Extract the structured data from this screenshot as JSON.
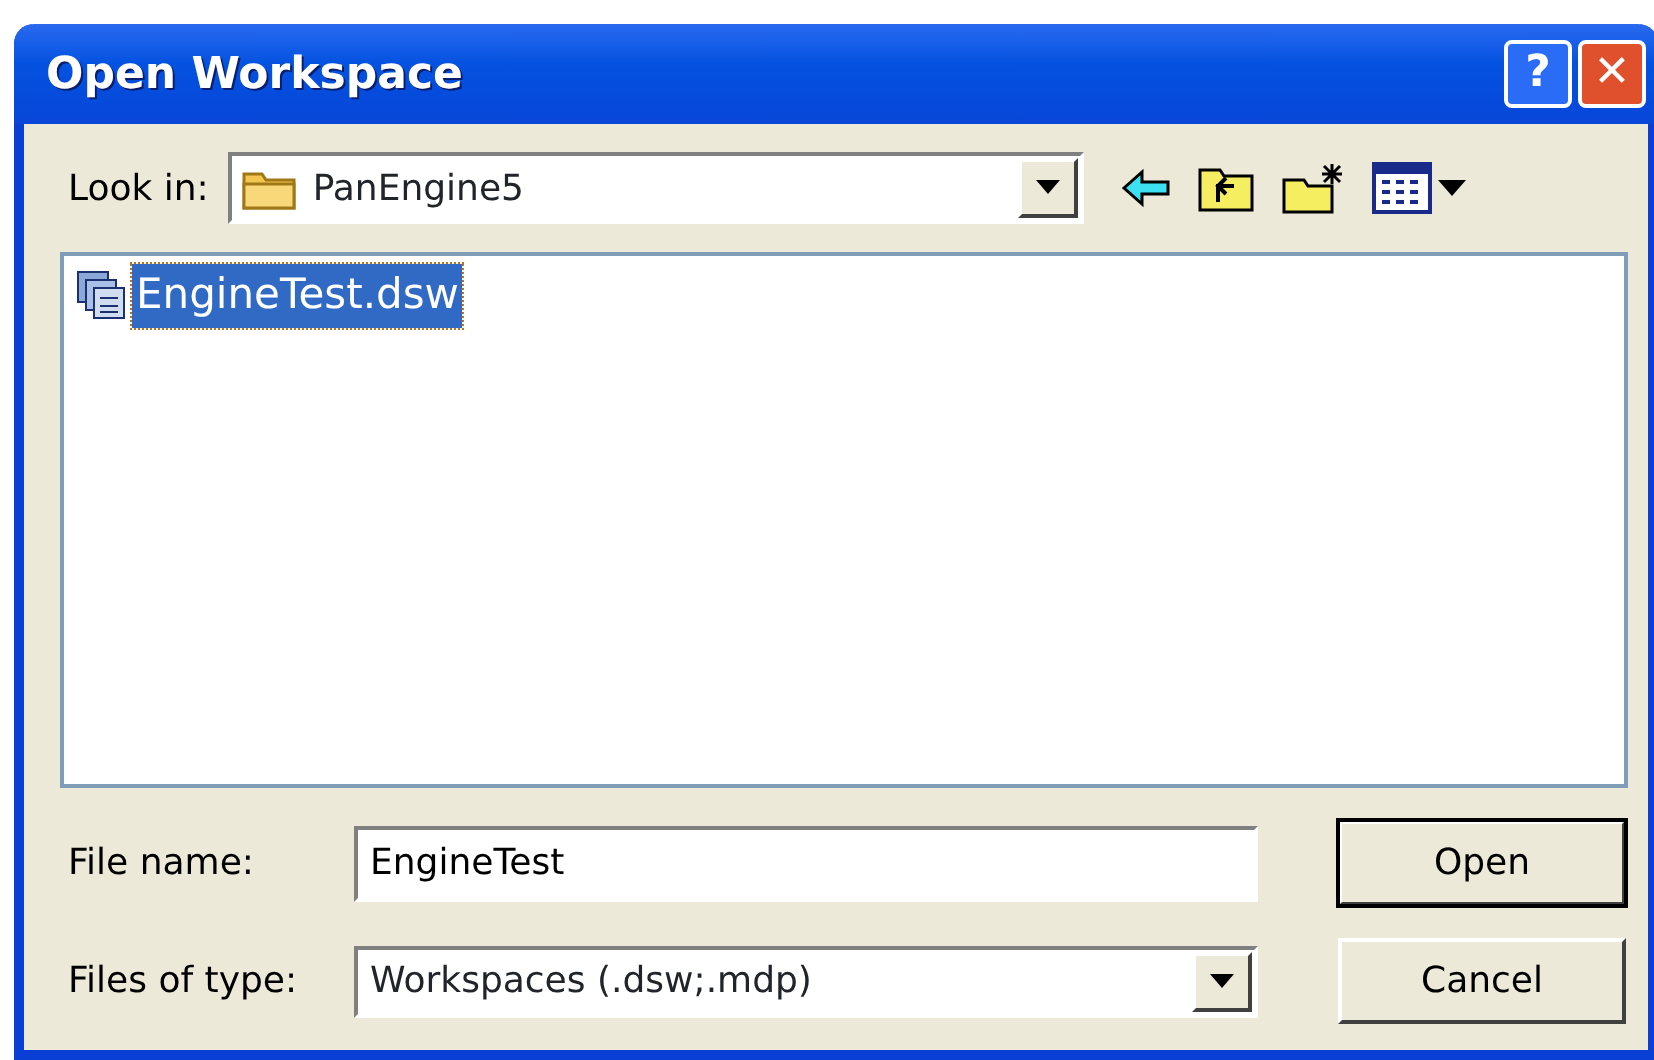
{
  "window": {
    "title": "Open Workspace"
  },
  "title_buttons": [
    {
      "kind": "help",
      "label": "?"
    },
    {
      "kind": "close",
      "label": "✕"
    }
  ],
  "look_in": {
    "label": "Look in:",
    "value": "PanEngine5"
  },
  "files": [
    {
      "name": "EngineTest.dsw",
      "selected": true
    }
  ],
  "file_name": {
    "label": "File name:",
    "value": "EngineTest"
  },
  "file_type": {
    "label": "Files of type:",
    "value": "Workspaces (.dsw;.mdp)"
  },
  "buttons": [
    {
      "label": "Open",
      "default": true
    },
    {
      "label": "Cancel",
      "default": false
    }
  ]
}
